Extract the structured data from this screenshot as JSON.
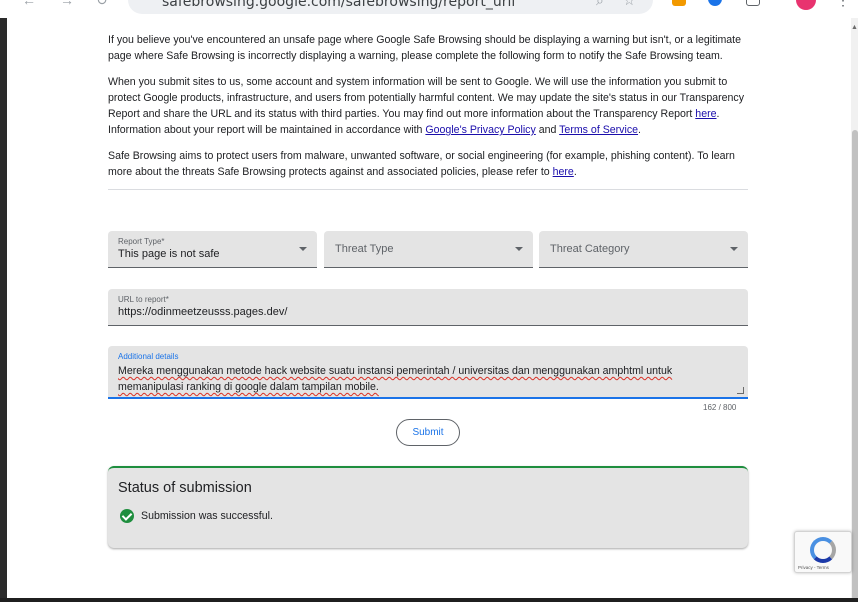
{
  "browser": {
    "url": "safebrowsing.google.com/safebrowsing/report_urll"
  },
  "intro": {
    "p1": "If you believe you've encountered an unsafe page where Google Safe Browsing should be displaying a warning but isn't, or a legitimate page where Safe Browsing is incorrectly displaying a warning, please complete the following form to notify the Safe Browsing team.",
    "p2_part1": "When you submit sites to us, some account and system information will be sent to Google. We will use the information you submit to protect Google products, infrastructure, and users from potentially harmful content. We may update the site's status in our Transparency Report and share the URL and its status with third parties. You may find out more information about the Transparency Report ",
    "p2_link_here": "here",
    "p2_part2": ". Information about your report will be maintained in accordance with ",
    "p2_link_privacy": "Google's Privacy Policy",
    "p2_part3": " and ",
    "p2_link_terms": "Terms of Service",
    "p2_part4": ".",
    "p3_part1": "Safe Browsing aims to protect users from malware, unwanted software, or social engineering (for example, phishing content). To learn more about the threats Safe Browsing protects against and associated policies, please refer to ",
    "p3_link_here": "here",
    "p3_part2": "."
  },
  "form": {
    "report_type": {
      "label": "Report Type*",
      "value": "This page is not safe"
    },
    "threat_type": {
      "placeholder": "Threat Type"
    },
    "threat_category": {
      "placeholder": "Threat Category"
    },
    "url_field": {
      "label": "URL to report*",
      "value": "https://odinmeetzeusss.pages.dev/"
    },
    "details": {
      "label": "Additional details",
      "value": "Mereka menggunakan metode hack website suatu instansi pemerintah / universitas dan menggunakan amphtml untuk memanipulasi ranking di google dalam tampilan mobile.",
      "counter": "162 / 800"
    },
    "submit_label": "Submit"
  },
  "status": {
    "title": "Status of submission",
    "message": "Submission was successful."
  },
  "recaptcha": {
    "links": "Privacy - Terms"
  },
  "colors": {
    "link": "#1a0dab",
    "accent_blue": "#1a73e8",
    "success_green": "#1e8e3e",
    "field_bg": "#e4e4e4"
  },
  "icons": [
    "back-arrow-icon",
    "forward-arrow-icon",
    "reload-icon",
    "zoom-icon",
    "bookmark-star-icon",
    "success-check-icon",
    "recaptcha-logo-icon",
    "chevron-down-icon"
  ]
}
